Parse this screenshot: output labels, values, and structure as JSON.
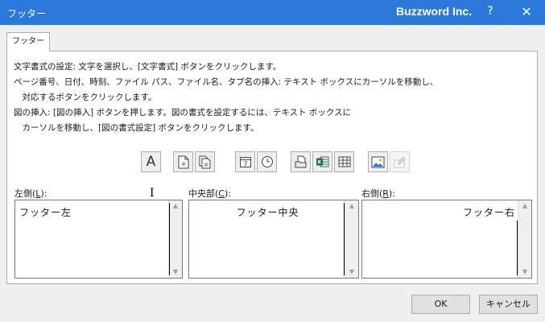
{
  "window": {
    "title": "フッター",
    "brand": "Buzzword Inc.",
    "help_label": "?",
    "close_label": "✕"
  },
  "tab": {
    "label": "フッター"
  },
  "instructions": [
    "文字書式の設定: 文字を選択し、[文字書式] ボタンをクリックします。",
    "ページ番号、日付、時刻、ファイル パス、ファイル名、タブ名の挿入: テキスト ボックスにカーソルを移動し、",
    "　対応するボタンをクリックします。",
    "図の挿入: [図の挿入] ボタンを押します。図の書式を設定するには、テキスト ボックスに",
    "　カーソルを移動し、[図の書式設定] ボタンをクリックします。"
  ],
  "toolbar": {
    "format_text_glyph": "A",
    "insert_date_glyph": "7"
  },
  "sections": {
    "left": {
      "label_prefix": "左側(",
      "accesskey": "L",
      "label_suffix": "):",
      "text": "フッター左"
    },
    "center": {
      "label_prefix": "中央部(",
      "accesskey": "C",
      "label_suffix": "):",
      "text": "フッター中央"
    },
    "right": {
      "label_prefix": "右側(",
      "accesskey": "R",
      "label_suffix": "):",
      "text": "フッター右"
    }
  },
  "buttons": {
    "ok": "OK",
    "cancel": "キャンセル"
  },
  "colors": {
    "titlebar": "#2b79d8",
    "excel_green": "#1e7145"
  }
}
